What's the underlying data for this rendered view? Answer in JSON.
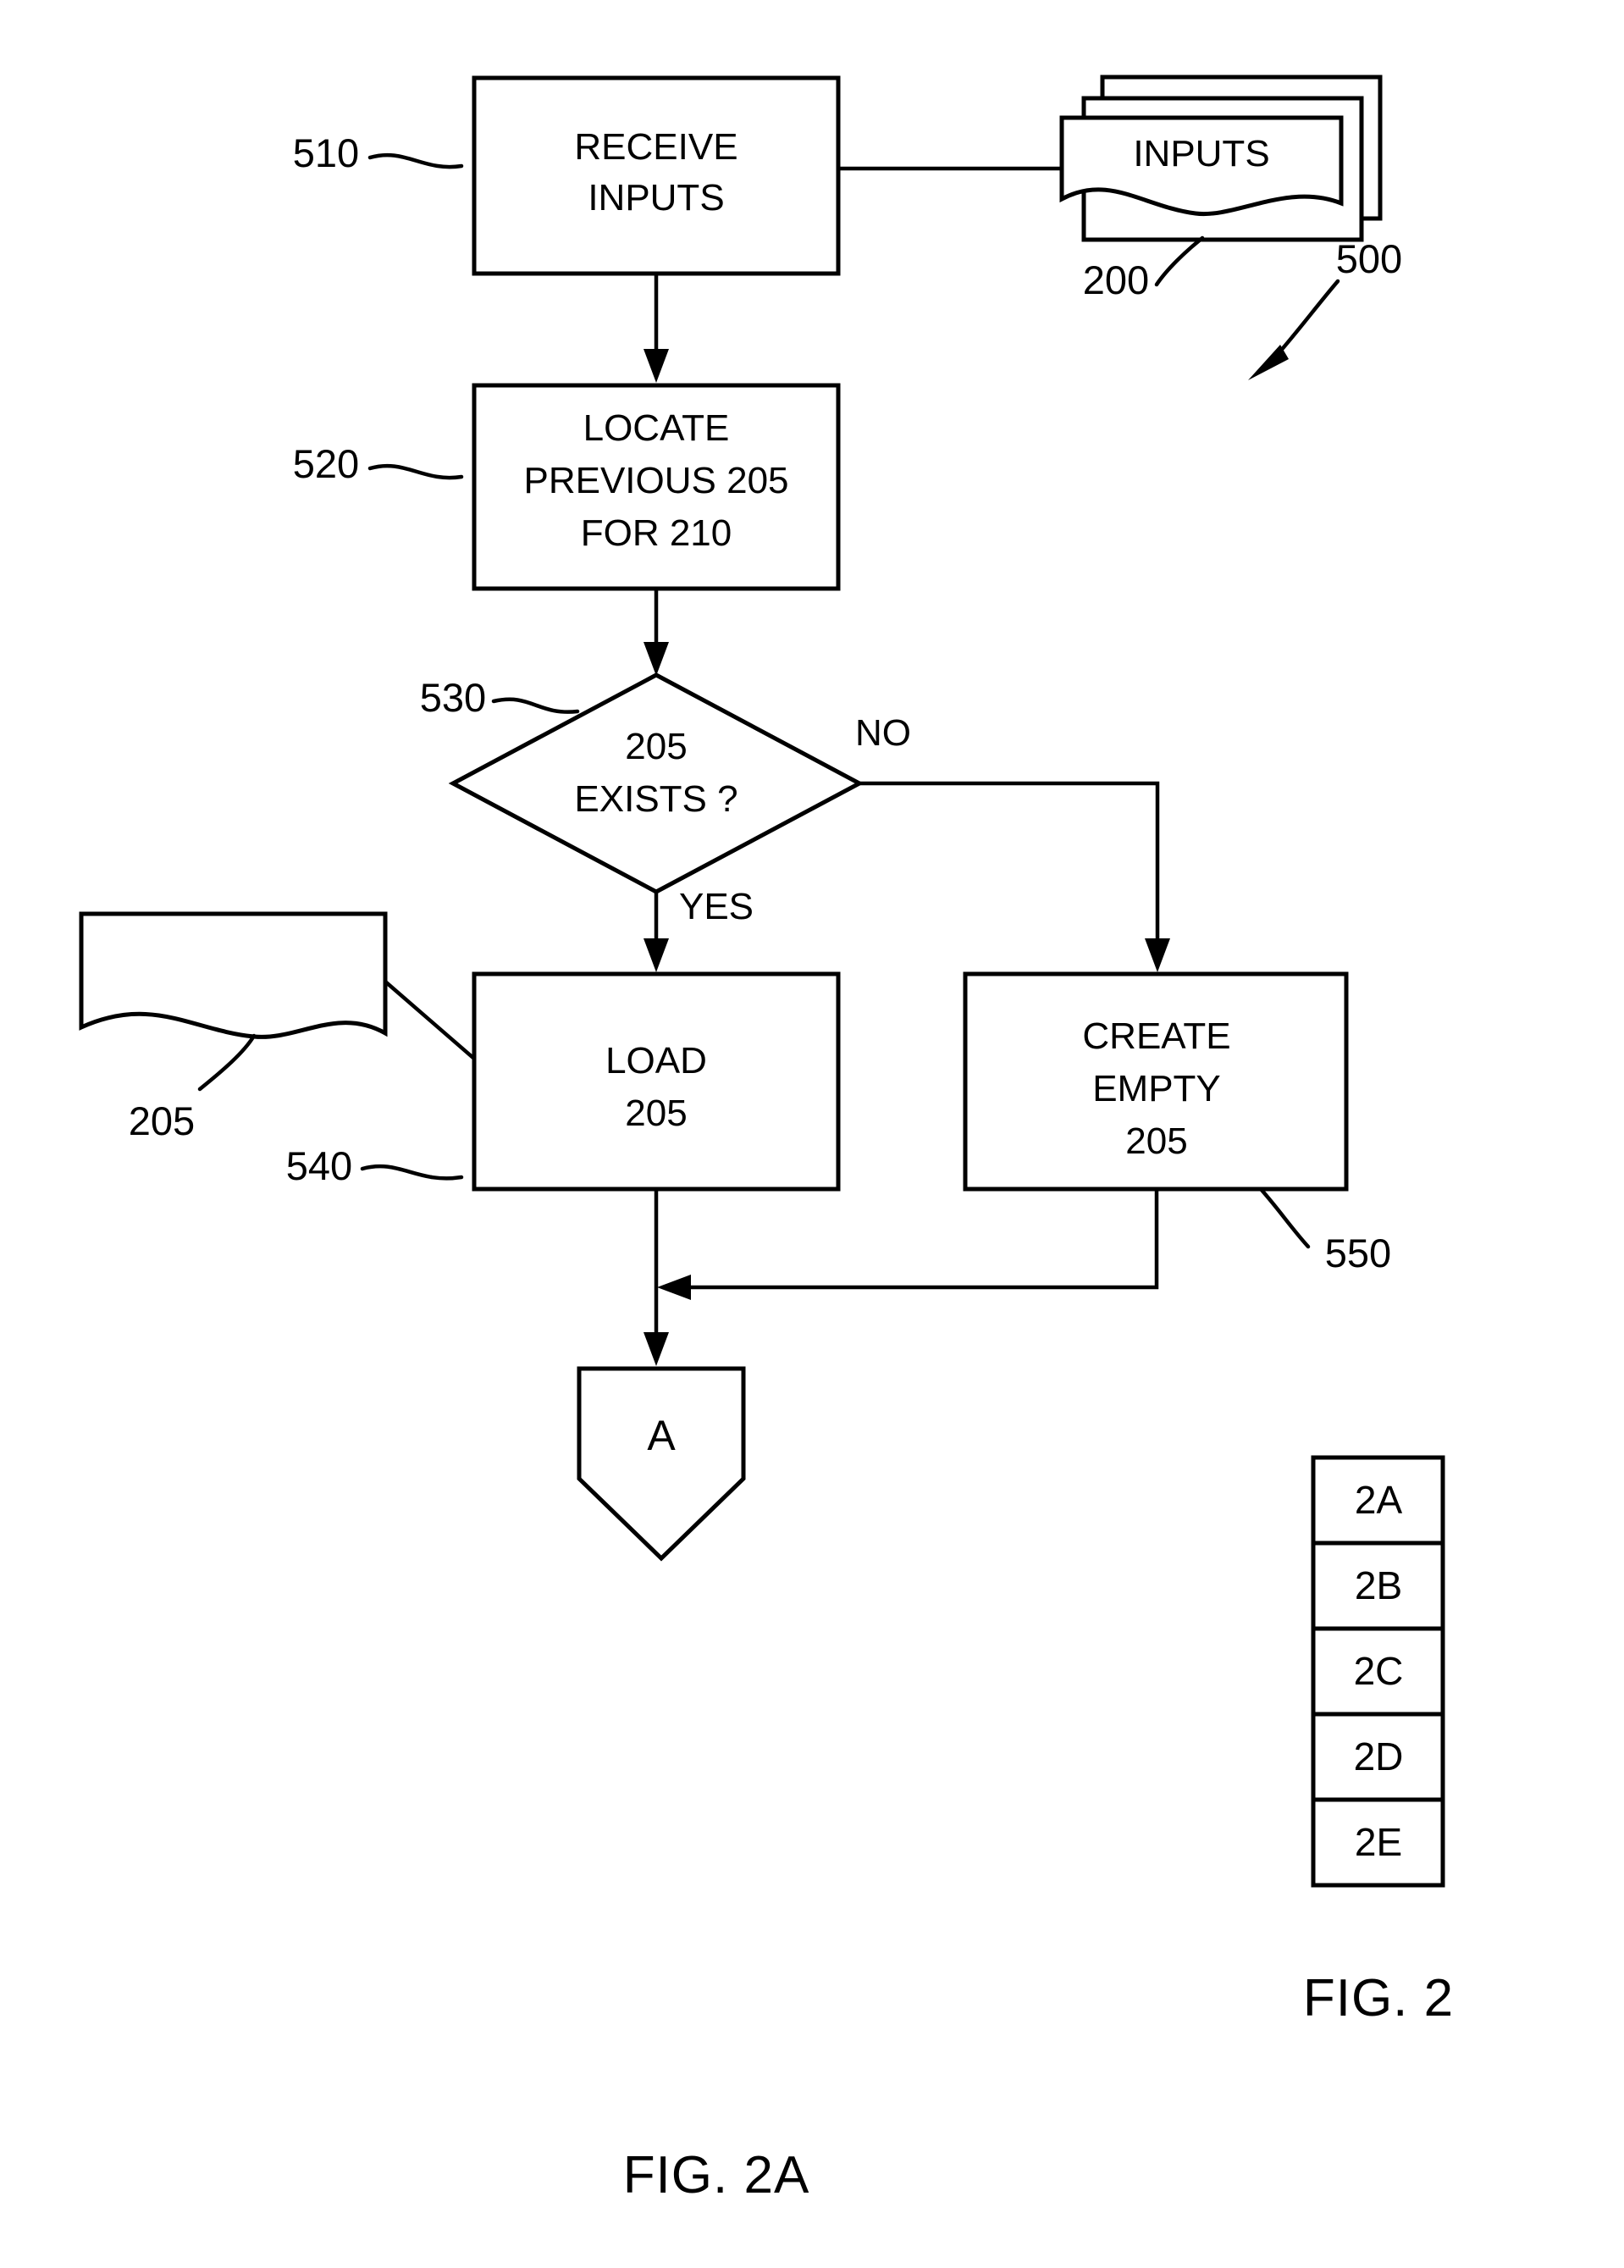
{
  "figure": {
    "main_caption": "FIG. 2A",
    "key_caption": "FIG. 2",
    "overall_ref": "500"
  },
  "nodes": {
    "receive_inputs": {
      "ref": "510",
      "line1": "RECEIVE",
      "line2": "INPUTS"
    },
    "inputs_doc": {
      "ref": "200",
      "label": "INPUTS"
    },
    "locate_previous": {
      "ref": "520",
      "line1": "LOCATE",
      "line2": "PREVIOUS 205",
      "line3": "FOR 210"
    },
    "decision": {
      "ref": "530",
      "line1": "205",
      "line2": "EXISTS ?",
      "branch_no": "NO",
      "branch_yes": "YES"
    },
    "data_205": {
      "ref": "205"
    },
    "load_205": {
      "ref": "540",
      "line1": "LOAD",
      "line2": "205"
    },
    "create_empty_205": {
      "ref": "550",
      "line1": "CREATE",
      "line2": "EMPTY",
      "line3": "205"
    },
    "connector_a": {
      "label": "A"
    }
  },
  "sheet_key": {
    "cells": [
      "2A",
      "2B",
      "2C",
      "2D",
      "2E"
    ]
  },
  "colors": {
    "ink": "#000000",
    "paper": "#ffffff"
  }
}
